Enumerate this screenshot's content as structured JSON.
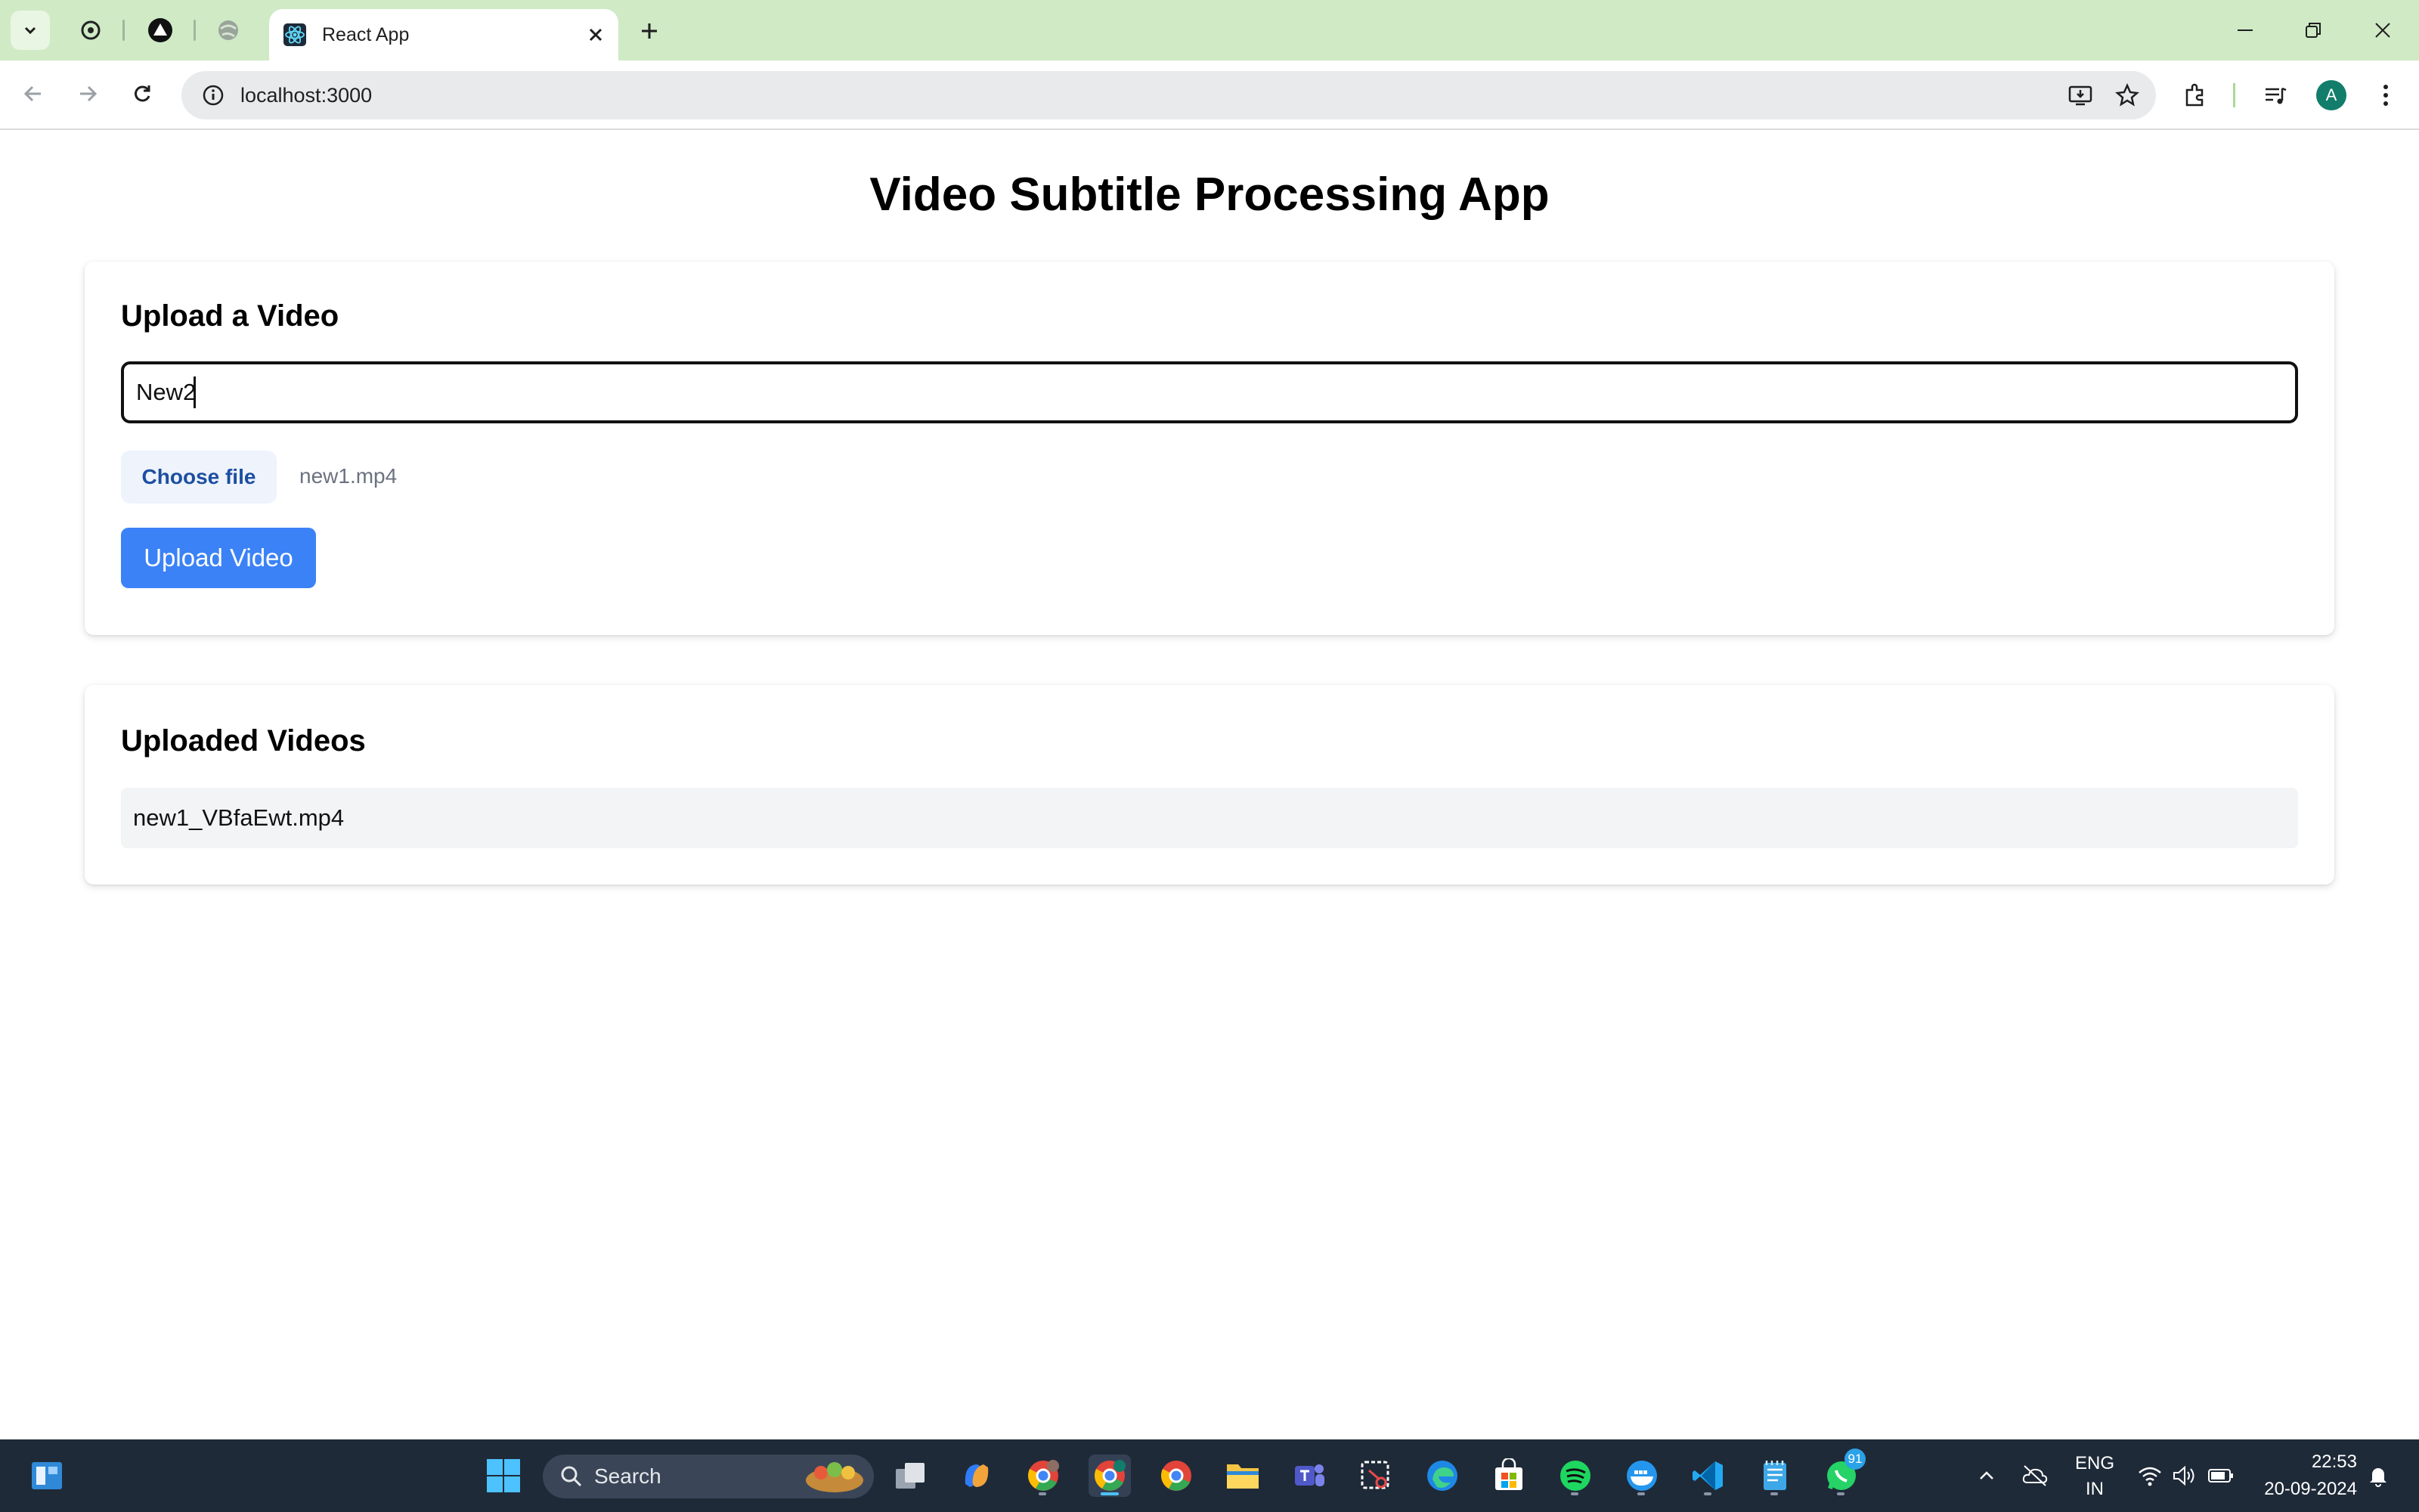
{
  "browser": {
    "active_tab_title": "React App",
    "url": "localhost:3000",
    "profile_initial": "A"
  },
  "app": {
    "title": "Video Subtitle Processing App",
    "upload_section": {
      "heading": "Upload a Video",
      "title_input_value": "New2",
      "choose_file_label": "Choose file",
      "selected_file": "new1.mp4",
      "upload_button_label": "Upload Video"
    },
    "videos_section": {
      "heading": "Uploaded Videos",
      "videos": [
        "new1_VBfaEwt.mp4"
      ]
    }
  },
  "taskbar": {
    "search_label": "Search",
    "language": "ENG",
    "region": "IN",
    "time": "22:53",
    "date": "20-09-2024",
    "whatsapp_badge": "91"
  },
  "colors": {
    "primary": "#3b82f6",
    "tabstrip": "#cfeac5",
    "taskbar": "#1f2a38"
  }
}
